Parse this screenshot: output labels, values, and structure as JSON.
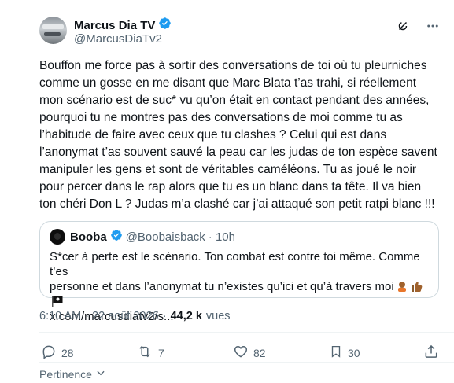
{
  "author": {
    "display_name": "Marcus Dia TV",
    "handle": "@MarcusDiaTv2"
  },
  "tweet_text": "Bouffon me force pas à sortir des conversations de toi où tu pleurniches\ncomme un gosse en me disant que Marc Blata t’as trahi, si réellement\nmon scénario est de suc* vu qu’on était en contact pendant des années,\npourquoi tu ne montres pas des conversations de moi comme tu as\nl’habitude de faire avec ceux que tu clashes ? Celui qui est dans\nl’anonymat t’as souvent sauvé la peau car les judas de ton espèce savent\nmanipuler les gens et sont de véritables caméléons. Tu as joué le noir\npour percer dans le rap alors que tu es un blanc dans ta tête. Il va bien\nton chéri Don L ? Judas m’a clashé car j’ai attaqué son petit ratpi blanc !!!",
  "quote": {
    "display_name": "Booba",
    "handle": "@Boobaisback",
    "time": "· 10h",
    "text_line1": "S*cer à perte est le scénario. Ton combat est contre toi même. Comme t’es",
    "text_line2": "personne et dans l’anonymat tu n’existes qu’ici et qu’à travers moi",
    "text_line3": "x.com/marcusdiatv2/s...",
    "emojis": [
      "man-facepalming-emoji",
      "thumbs-up-emoji",
      "pirate-flag-emoji"
    ]
  },
  "meta": {
    "time": "6:10 AM",
    "date": "· 22 août 2026",
    "dot": "·",
    "views_count": "44,2 k",
    "views_label": "vues"
  },
  "actions": {
    "replies": "28",
    "reposts": "7",
    "likes": "82",
    "bookmarks": "30"
  },
  "sort_label": "Pertinence",
  "colors": {
    "verified": "#1d9bf0",
    "muted_text": "#536471",
    "border": "#cfd9de"
  }
}
